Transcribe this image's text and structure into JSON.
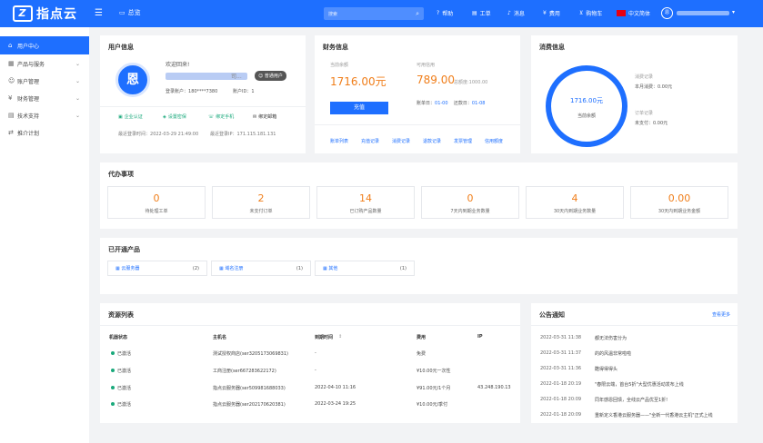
{
  "topbar": {
    "logo": "指点云",
    "console_label": "总览",
    "search_placeholder": "搜索",
    "nav": [
      {
        "icon": "help-icon",
        "label": "帮助"
      },
      {
        "icon": "ticket-icon",
        "label": "工单"
      },
      {
        "icon": "bell-icon",
        "label": "消息"
      },
      {
        "icon": "money-icon",
        "label": "费用"
      },
      {
        "icon": "cart-icon",
        "label": "购物车"
      },
      {
        "icon": "flag-icon",
        "label": "中文简体"
      }
    ],
    "avatar_char": "恩"
  },
  "sidebar": {
    "items": [
      {
        "label": "用户中心",
        "active": true
      },
      {
        "label": "产品与服务"
      },
      {
        "label": "账户管理"
      },
      {
        "label": "财务管理"
      },
      {
        "label": "技术支持"
      },
      {
        "label": "推介计划"
      }
    ]
  },
  "user_info": {
    "title": "用户信息",
    "avatar_char": "恩",
    "welcome": "欢迎回来!",
    "name_tail": "司...",
    "badge": "普通用户",
    "login_account_label": "登录账户：",
    "login_account_value": "180****7380",
    "user_id_label": "账户ID：",
    "user_id_value": "1",
    "links": [
      "企业认证",
      "设置密保",
      "绑定手机",
      "绑定邮箱"
    ],
    "last_login_time_label": "最近登录时间：",
    "last_login_time": "2022-03-29 21:49:00",
    "last_login_ip_label": "最近登录IP：",
    "last_login_ip": "171.115.181.131"
  },
  "finance": {
    "title": "财务信息",
    "balance_label": "当前余额",
    "balance": "1716.00元",
    "credit_label": "可用信用",
    "credit": "789.00",
    "credit_total": "总额度:1000.00",
    "recharge": "充值",
    "bill_day_label": "账单日：",
    "bill_day": "01-00",
    "repay_day_label": "还款日：",
    "repay_day": "01-08",
    "links": [
      "账单列表",
      "充值记录",
      "消费记录",
      "退款记录",
      "发票管理",
      "信用额度"
    ]
  },
  "consume": {
    "title": "消费信息",
    "ring_value": "1716.00元",
    "ring_label": "当前余额",
    "consume_records_label": "消费记录",
    "month_consume": "本月消费：0.00元",
    "order_records_label": "订单记录",
    "unpaid": "未支付：0.00元"
  },
  "todo": {
    "title": "代办事项",
    "items": [
      {
        "num": "0",
        "label": "待处理工单"
      },
      {
        "num": "2",
        "label": "未支付订单"
      },
      {
        "num": "14",
        "label": "已订购产品数量"
      },
      {
        "num": "0",
        "label": "7天内到期业务数量"
      },
      {
        "num": "4",
        "label": "30天内到期业务数量"
      },
      {
        "num": "0.00",
        "label": "30天内到期业务金额"
      }
    ]
  },
  "products": {
    "title": "已开通产品",
    "items": [
      {
        "label": "云服务器",
        "count": "(2)"
      },
      {
        "label": "域名注册",
        "count": "(1)"
      },
      {
        "label": "其他",
        "count": "(1)"
      }
    ]
  },
  "resources": {
    "title": "资源列表",
    "headers": [
      "机器状态",
      "主机名",
      "到期时间",
      "费用",
      "IP"
    ],
    "rows": [
      {
        "status": "已激活",
        "host": "测试授权商店(ser3205173069831)",
        "expire": "-",
        "fee": "免费",
        "ip": ""
      },
      {
        "status": "已激活",
        "host": "工商注册(ser667283622172)",
        "expire": "-",
        "fee": "¥10.00元一次性",
        "ip": ""
      },
      {
        "status": "已激活",
        "host": "指点云服务器(ser509981688033)",
        "expire": "2022-04-10 11:16",
        "fee": "¥91.00元/1个月",
        "ip": "43.248.190.13"
      },
      {
        "status": "已激活",
        "host": "指点云服务器(ser202170620381)",
        "expire": "2022-03-24 19:25",
        "fee": "¥10.00元/季付",
        "ip": ""
      }
    ]
  },
  "notices": {
    "title": "公告通知",
    "more": "查看更多",
    "items": [
      {
        "date": "2022-03-31 11:38",
        "title": "都无法伤害分为"
      },
      {
        "date": "2022-03-31 11:37",
        "title": "的的风温非常啦啦"
      },
      {
        "date": "2022-03-31 11:36",
        "title": "酷得得得头"
      },
      {
        "date": "2022-01-18 20:19",
        "title": "\"春限云端，首台5折\"大型优惠活动发布上线"
      },
      {
        "date": "2022-01-18 20:09",
        "title": "同年感恩回馈，全线云产品优至1折!"
      },
      {
        "date": "2022-01-18 20:09",
        "title": "重新定义香港云服务器——\"全新一代香港云主机\"正式上线"
      }
    ]
  },
  "colors": {
    "primary": "#1e6fff",
    "orange": "#f07e1a",
    "green": "#19a97b"
  }
}
